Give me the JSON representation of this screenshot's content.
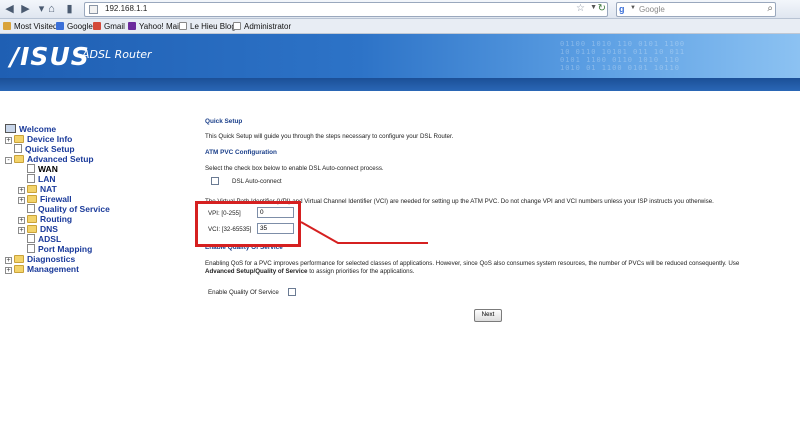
{
  "browser": {
    "url": "192.168.1.1",
    "search_placeholder": "Google"
  },
  "bookmarks": [
    {
      "label": "Most Visited",
      "icon": "star-folder-icon"
    },
    {
      "label": "Google",
      "icon": "google-icon"
    },
    {
      "label": "Gmail",
      "icon": "gmail-icon"
    },
    {
      "label": "Yahoo! Mail",
      "icon": "yahoo-icon"
    },
    {
      "label": "Le Hieu Blogs",
      "icon": "page-icon"
    },
    {
      "label": "Administrator",
      "icon": "page-icon"
    }
  ],
  "header": {
    "logo": "/ISUS",
    "product": "ADSL Router"
  },
  "sidebar": {
    "items": [
      {
        "label": "Welcome",
        "level": 0,
        "icon": "computer-icon"
      },
      {
        "label": "Device Info",
        "level": 1,
        "icon": "folder-icon",
        "expander": "+"
      },
      {
        "label": "Quick Setup",
        "level": 1,
        "icon": "document-icon"
      },
      {
        "label": "Advanced Setup",
        "level": 1,
        "icon": "folder-icon",
        "expander": "-"
      },
      {
        "label": "WAN",
        "level": 2,
        "icon": "document-icon",
        "current": true
      },
      {
        "label": "LAN",
        "level": 2,
        "icon": "document-icon"
      },
      {
        "label": "NAT",
        "level": 2,
        "icon": "folder-icon",
        "expander": "+"
      },
      {
        "label": "Firewall",
        "level": 2,
        "icon": "folder-icon",
        "expander": "+"
      },
      {
        "label": "Quality of Service",
        "level": 2,
        "icon": "document-icon"
      },
      {
        "label": "Routing",
        "level": 2,
        "icon": "folder-icon",
        "expander": "+"
      },
      {
        "label": "DNS",
        "level": 2,
        "icon": "folder-icon",
        "expander": "+"
      },
      {
        "label": "ADSL",
        "level": 2,
        "icon": "document-icon"
      },
      {
        "label": "Port Mapping",
        "level": 2,
        "icon": "document-icon"
      },
      {
        "label": "Diagnostics",
        "level": 1,
        "icon": "folder-icon",
        "expander": "+"
      },
      {
        "label": "Management",
        "level": 1,
        "icon": "folder-icon",
        "expander": "+"
      }
    ]
  },
  "main": {
    "title": "Quick Setup",
    "intro": "This Quick Setup will guide you through the steps necessary to configure your DSL Router.",
    "atm_heading": "ATM PVC Configuration",
    "atm_desc": "Select the check box below to enable DSL Auto-connect process.",
    "auto_connect_label": "DSL Auto-connect",
    "vpi_vci_desc": "The Virtual Path Identifier (VPI) and Virtual Channel Identifier (VCI) are needed for setting up the ATM PVC. Do not change VPI and VCI numbers unless your ISP instructs you otherwise.",
    "vpi_label": "VPI: [0-255]",
    "vpi_value": "0",
    "vci_label": "VCI: [32-65535]",
    "vci_value": "35",
    "qos_heading": "Enable Quality Of Service",
    "qos_desc_1": "Enabling QoS for a PVC improves performance for selected classes of applications. However, since QoS also consumes system resources, the number of PVCs will be reduced consequently. Use",
    "qos_desc_link": "Advanced Setup/Quality of Service",
    "qos_desc_2": " to assign priorities for the applications.",
    "qos_checkbox_label": "Enable Quality Of Service",
    "next_label": "Next"
  },
  "colors": {
    "banner": "#2d73c7",
    "link": "#1a3a9a",
    "highlight": "#d52020"
  }
}
